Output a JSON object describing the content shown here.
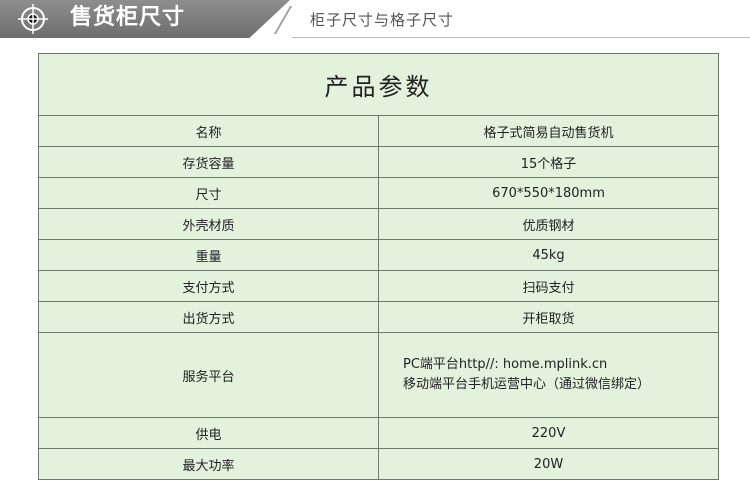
{
  "header": {
    "title": "售货柜尺寸",
    "subtitle": "柜子尺寸与格子尺寸"
  },
  "table": {
    "title": "产品参数",
    "rows": [
      {
        "label": "名称",
        "value": "格子式简易自动售货机"
      },
      {
        "label": "存货容量",
        "value": "15个格子"
      },
      {
        "label": "尺寸",
        "value": "670*550*180mm"
      },
      {
        "label": "外壳材质",
        "value": "优质钢材"
      },
      {
        "label": "重量",
        "value": "45kg"
      },
      {
        "label": "支付方式",
        "value": "扫码支付"
      },
      {
        "label": "出货方式",
        "value": "开柜取货"
      }
    ],
    "platform": {
      "label": "服务平台",
      "line1": "PC端平台http//: home.mplink.cn",
      "line2": "移动端平台手机运营中心（通过微信绑定）"
    },
    "rows_after": [
      {
        "label": "供电",
        "value": "220V"
      },
      {
        "label": "最大功率",
        "value": "20W"
      }
    ]
  },
  "colors": {
    "banner": "#7d7d7d",
    "table_bg": "#e3f2dc",
    "border": "#6e7a6a"
  },
  "icons": {
    "header": "crosshair-target-icon"
  }
}
